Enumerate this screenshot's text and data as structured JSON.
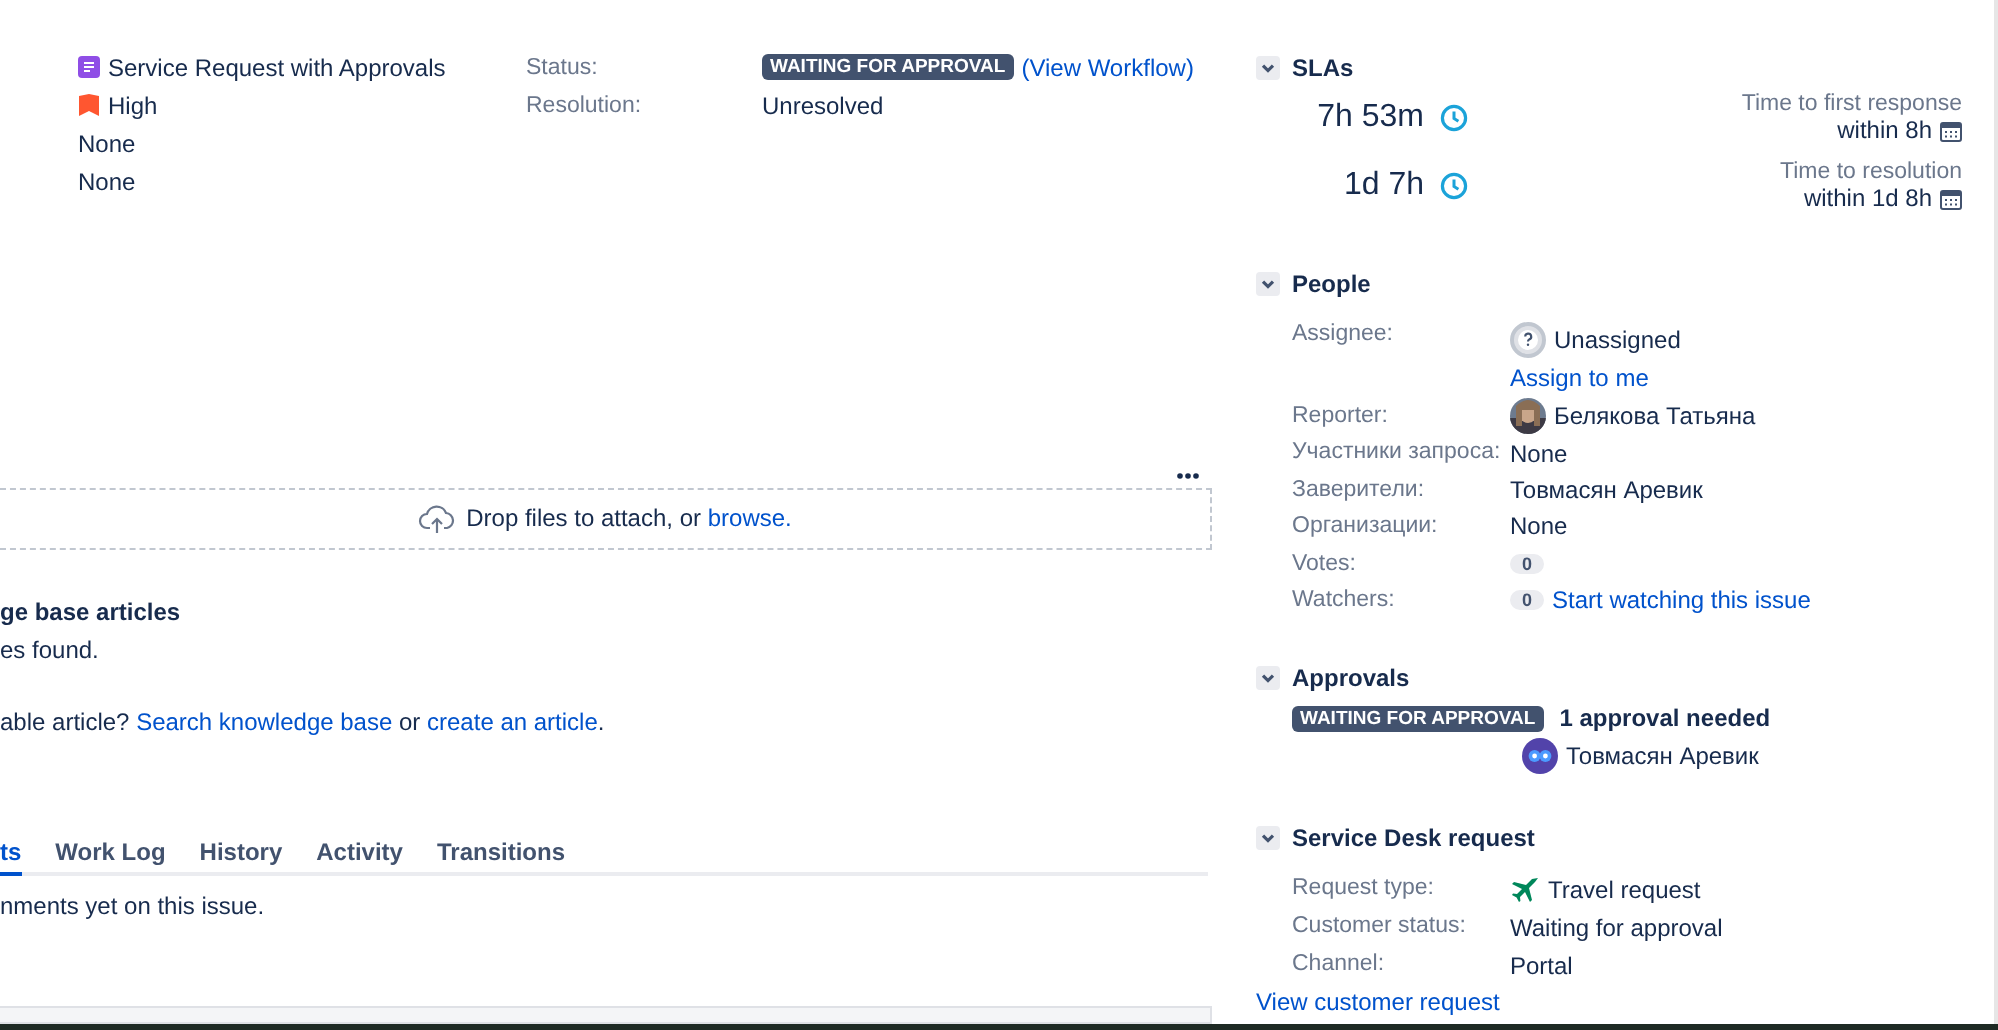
{
  "details": [
    {
      "kind": "type",
      "text": "Service Request with Approvals"
    },
    {
      "kind": "priority",
      "text": "High"
    },
    {
      "kind": "plain",
      "text": "None"
    },
    {
      "kind": "plain",
      "text": "None"
    }
  ],
  "status": {
    "status_label": "Status:",
    "lozenge": "WAITING FOR APPROVAL",
    "workflow_link": "(View Workflow)",
    "resolution_label": "Resolution:",
    "resolution_value": "Unresolved"
  },
  "attachments": {
    "text": "Drop files to attach, or",
    "link": "browse."
  },
  "knowledge_base": {
    "heading": "ge base articles",
    "empty": "es found.",
    "prompt": "able article?",
    "search_link": "Search knowledge base",
    "or": "or",
    "create_link": "create an article",
    "end": "."
  },
  "tabs": [
    {
      "label": "ts",
      "selected": true
    },
    {
      "label": "Work Log",
      "selected": false
    },
    {
      "label": "History",
      "selected": false
    },
    {
      "label": "Activity",
      "selected": false
    },
    {
      "label": "Transitions",
      "selected": false
    }
  ],
  "comments_empty": "nments yet on this issue.",
  "slas": {
    "title": "SLAs",
    "items": [
      {
        "time": "7h 53m",
        "name": "Time to first response",
        "target": "within 8h"
      },
      {
        "time": "1d 7h",
        "name": "Time to resolution",
        "target": "within 1d 8h"
      }
    ]
  },
  "people": {
    "title": "People",
    "fields": [
      {
        "kind": "assignee",
        "label": "Assignee:",
        "value": "Unassigned",
        "link": "Assign to me"
      },
      {
        "kind": "user",
        "label": "Reporter:",
        "value": "Белякова Татьяна"
      },
      {
        "kind": "text",
        "label": "Участники запроса:",
        "value": "None"
      },
      {
        "kind": "text",
        "label": "Заверители:",
        "value": "Товмасян Аревик"
      },
      {
        "kind": "text",
        "label": "Организации:",
        "value": "None"
      },
      {
        "kind": "count",
        "label": "Votes:",
        "count": "0"
      },
      {
        "kind": "count",
        "label": "Watchers:",
        "count": "0",
        "link": "Start watching this issue"
      }
    ]
  },
  "approvals": {
    "title": "Approvals",
    "lozenge": "WAITING FOR APPROVAL",
    "needed": "1 approval needed",
    "approver": "Товмасян Аревик"
  },
  "service_desk": {
    "title": "Service Desk request",
    "fields": [
      {
        "kind": "request_type",
        "label": "Request type:",
        "value": "Travel request"
      },
      {
        "kind": "text",
        "label": "Customer status:",
        "value": "Waiting for approval"
      },
      {
        "kind": "text",
        "label": "Channel:",
        "value": "Portal"
      }
    ],
    "link": "View customer request"
  }
}
